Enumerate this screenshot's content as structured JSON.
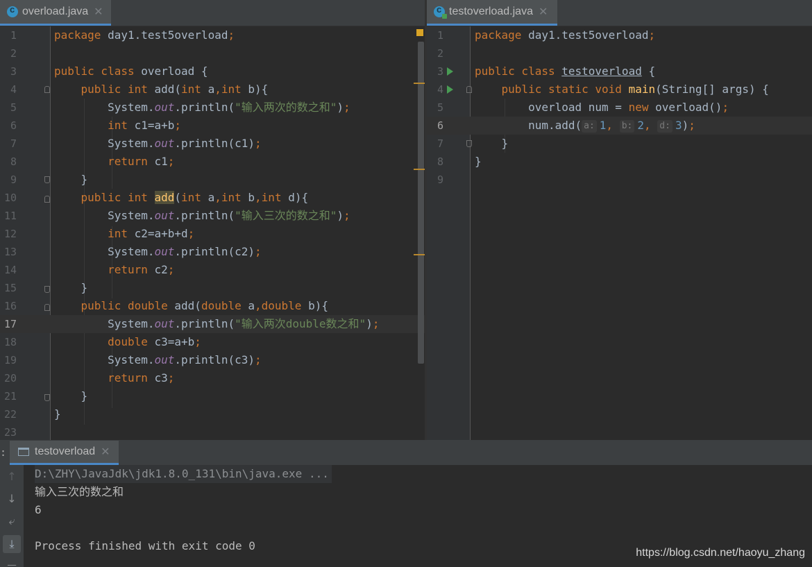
{
  "left_editor": {
    "tab_label": "overload.java",
    "close_glyph": "✕",
    "lines": [
      {
        "n": "1"
      },
      {
        "n": "2"
      },
      {
        "n": "3"
      },
      {
        "n": "4"
      },
      {
        "n": "5"
      },
      {
        "n": "6"
      },
      {
        "n": "7"
      },
      {
        "n": "8"
      },
      {
        "n": "9"
      },
      {
        "n": "10"
      },
      {
        "n": "11"
      },
      {
        "n": "12"
      },
      {
        "n": "13"
      },
      {
        "n": "14"
      },
      {
        "n": "15"
      },
      {
        "n": "16"
      },
      {
        "n": "17"
      },
      {
        "n": "18"
      },
      {
        "n": "19"
      },
      {
        "n": "20"
      },
      {
        "n": "21"
      },
      {
        "n": "22"
      },
      {
        "n": "23"
      }
    ],
    "current_line": "17",
    "code": {
      "l1_kw": "package",
      "l1_rest": " day1.test5overload",
      "l1_semi": ";",
      "l3_kw": "public class",
      "l3_rest": " overload {",
      "l4_kw1": "public int",
      "l4_name": " add",
      "l4_p1": "(",
      "l4_kw2": "int",
      "l4_a": " a",
      "l4_c1": ",",
      "l4_kw3": "int",
      "l4_b": " b){",
      "l5_sys": "System.",
      "l5_out": "out",
      "l5_println": ".println(",
      "l5_str": "\"输入两次的数之和\"",
      "l5_end": ")",
      "l5_semi": ";",
      "l6_kw": "int",
      "l6_rest": " c1=a+b",
      "l6_semi": ";",
      "l7_sys": "System.",
      "l7_out": "out",
      "l7_rest": ".println(c1)",
      "l7_semi": ";",
      "l8_kw": "return",
      "l8_rest": " c1",
      "l8_semi": ";",
      "l9_text": "}",
      "l10_kw1": "public int",
      "l10_sp": " ",
      "l10_name": "add",
      "l10_p1": "(",
      "l10_kw2": "int",
      "l10_a": " a",
      "l10_c1": ",",
      "l10_kw3": "int",
      "l10_b": " b",
      "l10_c2": ",",
      "l10_kw4": "int",
      "l10_d": " d){",
      "l11_sys": "System.",
      "l11_out": "out",
      "l11_println": ".println(",
      "l11_str": "\"输入三次的数之和\"",
      "l11_end": ")",
      "l11_semi": ";",
      "l12_kw": "int",
      "l12_rest": " c2=a+b+d",
      "l12_semi": ";",
      "l13_sys": "System.",
      "l13_out": "out",
      "l13_rest": ".println(c2)",
      "l13_semi": ";",
      "l14_kw": "return",
      "l14_rest": " c2",
      "l14_semi": ";",
      "l15_text": "}",
      "l16_kw1": "public double",
      "l16_name": " add",
      "l16_p1": "(",
      "l16_kw2": "double",
      "l16_a": " a",
      "l16_c1": ",",
      "l16_kw3": "double",
      "l16_b": " b){",
      "l17_sys": "System.",
      "l17_out": "out",
      "l17_println": ".println(",
      "l17_str": "\"输入两次double数之和\"",
      "l17_end": ")",
      "l17_semi": ";",
      "l18_kw": "double",
      "l18_rest": " c3=a+b",
      "l18_semi": ";",
      "l19_sys": "System.",
      "l19_out": "out",
      "l19_rest": ".println(c3)",
      "l19_semi": ";",
      "l20_kw": "return",
      "l20_rest": " c3",
      "l20_semi": ";",
      "l21_text": "}",
      "l22_text": "}"
    }
  },
  "right_editor": {
    "tab_label": "testoverload.java",
    "close_glyph": "✕",
    "lines": [
      {
        "n": "1"
      },
      {
        "n": "2"
      },
      {
        "n": "3"
      },
      {
        "n": "4"
      },
      {
        "n": "5"
      },
      {
        "n": "6"
      },
      {
        "n": "7"
      },
      {
        "n": "8"
      },
      {
        "n": "9"
      }
    ],
    "current_line": "6",
    "code": {
      "l1_kw": "package",
      "l1_rest": " day1.test5overload",
      "l1_semi": ";",
      "l3_kw": "public class",
      "l3_sp": " ",
      "l3_name": "testoverload",
      "l3_brace": " {",
      "l4_kw": "public static void",
      "l4_sp": " ",
      "l4_name": "main",
      "l4_rest": "(String[] args) {",
      "l5_rest1": "overload num = ",
      "l5_kw": "new",
      "l5_rest2": " overload()",
      "l5_semi": ";",
      "l6_call": "num.add(",
      "l6_hint_a": "a:",
      "l6_v1": "1",
      "l6_c1": ",",
      "l6_hint_b": "b:",
      "l6_v2": "2",
      "l6_c2": ",",
      "l6_hint_d": "d:",
      "l6_v3": "3",
      "l6_end": ")",
      "l6_semi": ";",
      "l7_text": "}",
      "l8_text": "}"
    }
  },
  "run_window": {
    "tab_label": "testoverload",
    "close_glyph": "✕",
    "header_colon": ":",
    "side_buttons": {
      "up": "↑",
      "down": "↓",
      "wrap": "⤶",
      "scroll_end": "⤓",
      "print": "▬"
    },
    "console_lines": [
      "D:\\ZHY\\JavaJdk\\jdk1.8.0_131\\bin\\java.exe ...",
      "输入三次的数之和",
      "6",
      "",
      "Process finished with exit code 0"
    ]
  },
  "watermark": "https://blog.csdn.net/haoyu_zhang",
  "colors": {
    "keyword": "#cc7832",
    "string": "#6a8759",
    "static_field": "#9876aa",
    "number": "#6897bb",
    "method_decl": "#ffc66d",
    "tab_accent": "#4a88c7",
    "run_green": "#499c54"
  }
}
